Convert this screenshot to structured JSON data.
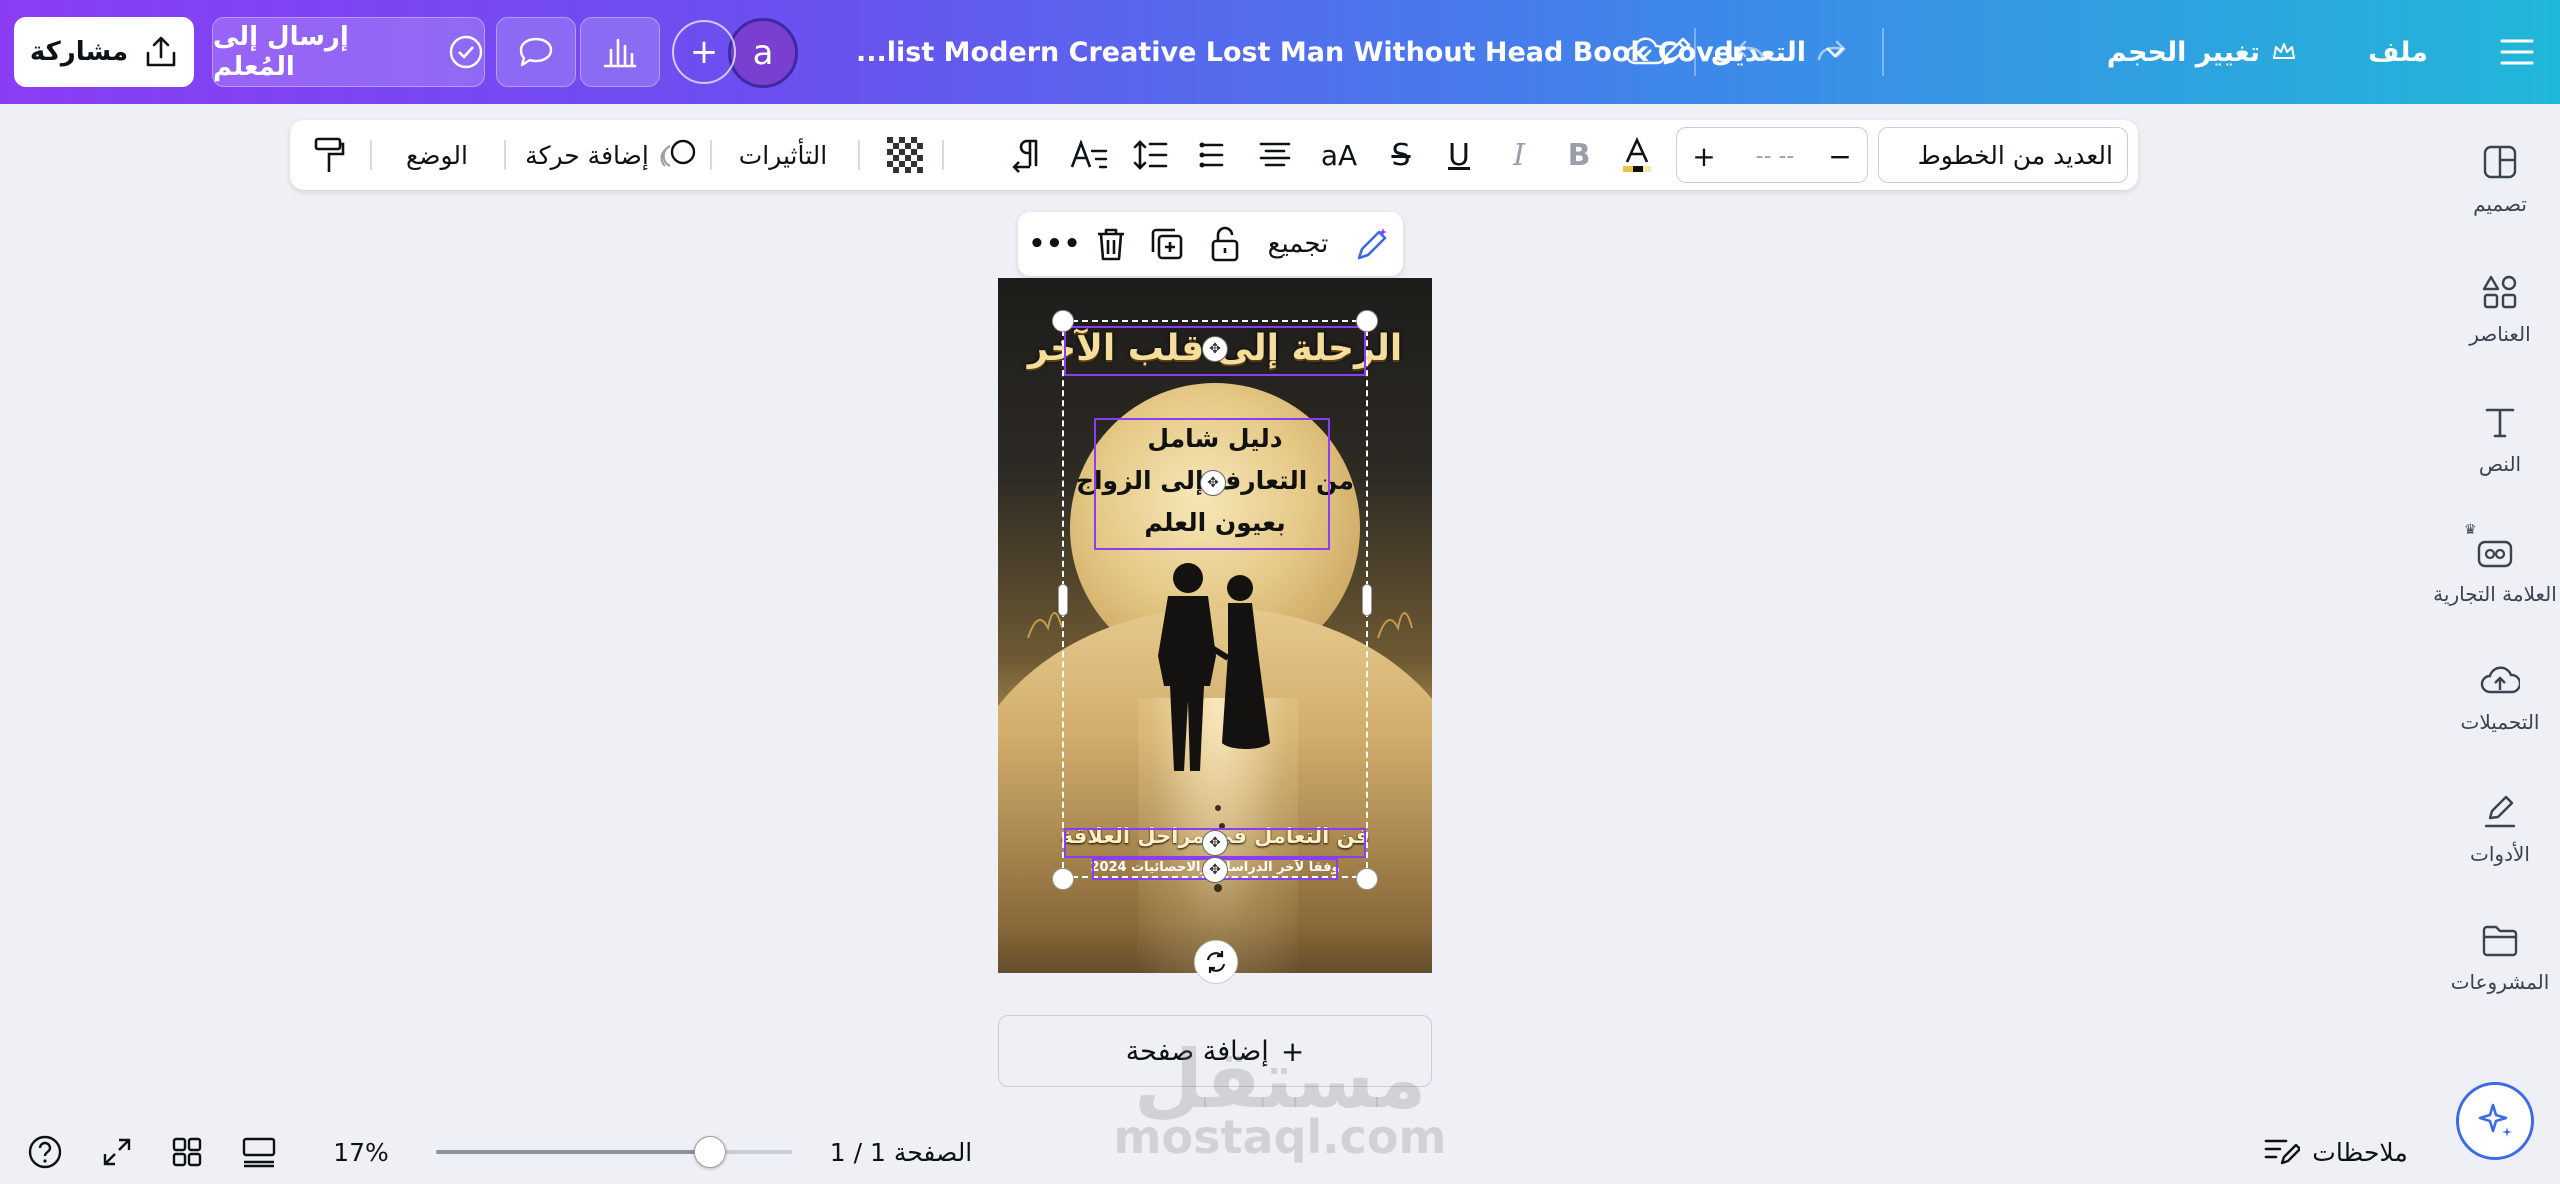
{
  "topbar": {
    "menu_label": "ملف",
    "resize_label": "تغيير الحجم",
    "edit_label": "التعديل",
    "doc_title": "...list Modern Creative Lost Man Without Head Book Cover",
    "avatar_letter": "a",
    "send_label": "إرسال إلى المُعلم",
    "share_label": "مشاركة"
  },
  "sidebar": {
    "items": [
      {
        "label": "تصميم"
      },
      {
        "label": "العناصر"
      },
      {
        "label": "النص"
      },
      {
        "label": "العلامة التجارية"
      },
      {
        "label": "التحميلات"
      },
      {
        "label": "الأدوات"
      },
      {
        "label": "المشروعات"
      }
    ]
  },
  "toolbar": {
    "font_name": "العديد من الخطوط",
    "font_size": "-- --",
    "size_minus": "−",
    "size_plus": "+",
    "case_label": "aA",
    "effects_label": "التأثيرات",
    "animate_label": "إضافة حركة",
    "position_label": "الوضع"
  },
  "context_bar": {
    "group_label": "تجميع",
    "more_label": "•••"
  },
  "page": {
    "title": "الرحلة إلى قلب الآخر",
    "subtitle_lines": [
      "دليل شامل",
      "من التعارف إلى الزواج",
      "بعيون العلم"
    ],
    "bottom_line": "فن التعامل في مراحل العلاقة",
    "tiny_line": "وفقاً لآخر الدراسات والاحصائيات 2024"
  },
  "add_page_label": "إضافة صفحة",
  "bottom": {
    "notes_label": "ملاحظات",
    "page_indicator": "الصفحة 1 / 1",
    "zoom": "17%",
    "zoom_fraction": 0.77
  },
  "watermark": {
    "line1": "مستقل",
    "line2": "mostaql.com"
  },
  "colors": {
    "accent": "#8b3df5",
    "gradient_start": "#8b3df5",
    "gradient_end": "#21b7d8"
  }
}
